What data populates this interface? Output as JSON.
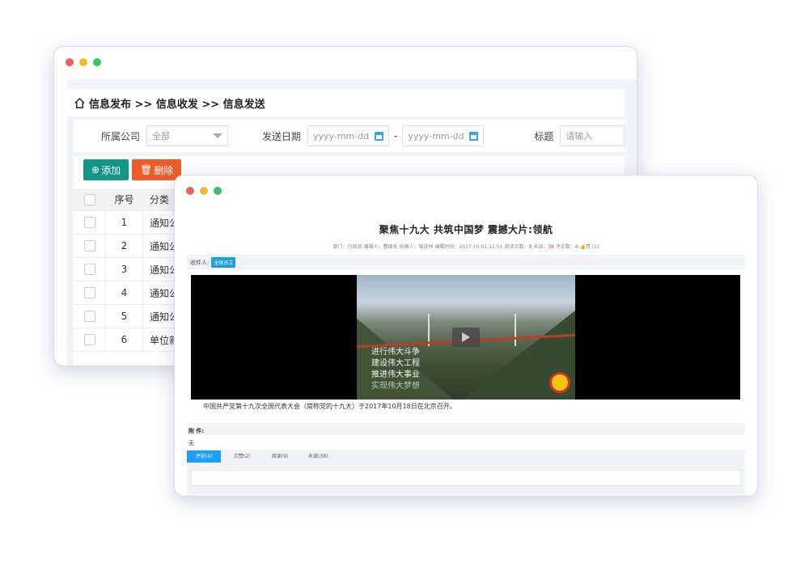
{
  "back_window": {
    "breadcrumb": "信息发布 >> 信息收发 >> 信息发送",
    "filters": {
      "company_label": "所属公司",
      "company_value": "全部",
      "date_label": "发送日期",
      "date_from_placeholder": "yyyy-mm-dd",
      "date_sep": "-",
      "date_to_placeholder": "yyyy-mm-dd",
      "title_label": "标题",
      "title_placeholder": "请输入"
    },
    "toolbar": {
      "add_label": "添加",
      "delete_label": "删除"
    },
    "table": {
      "headers": [
        "序号",
        "分类"
      ],
      "rows": [
        {
          "no": "1",
          "category": "通知公"
        },
        {
          "no": "2",
          "category": "通知公"
        },
        {
          "no": "3",
          "category": "通知公"
        },
        {
          "no": "4",
          "category": "通知公"
        },
        {
          "no": "5",
          "category": "通知公"
        },
        {
          "no": "6",
          "category": "单位新"
        }
      ]
    }
  },
  "front_window": {
    "article_title": "聚焦十九大 共筑中国梦 震撼大片:领航",
    "meta": {
      "dept_label": "部门：",
      "dept": "行政部",
      "editor_label": "编辑人：",
      "editor": "曹继岳",
      "reviewer_label": "核稿人：",
      "reviewer": "喻茂林",
      "time_label": "编辑时间：",
      "time": "2017-10-01 11:51",
      "read_label": "阅读次数：",
      "read": "9",
      "unread_label": "未读：",
      "unread": "38",
      "comments_label": "评论数：",
      "comments": "4",
      "likes": "赞 (2)"
    },
    "recipients_label": "收件人:",
    "recipient_tag": "全体员工",
    "video_lines": [
      "进行伟大斗争",
      "建设伟大工程",
      "推进伟大事业",
      "实现伟大梦想"
    ],
    "caption": "中国共产党第十九次全国代表大会（简称党的十九大）于2017年10月18日在北京召开。",
    "attachments_label": "附 件:",
    "attachments_value": "无",
    "tabs": [
      "评论(4)",
      "点赞(2)",
      "阅读(9)",
      "未读(38)"
    ]
  },
  "colors": {
    "add_button": "#129688",
    "delete_button": "#f05a28",
    "tag": "#1f9ee0",
    "active_tab": "#1e9fff"
  }
}
